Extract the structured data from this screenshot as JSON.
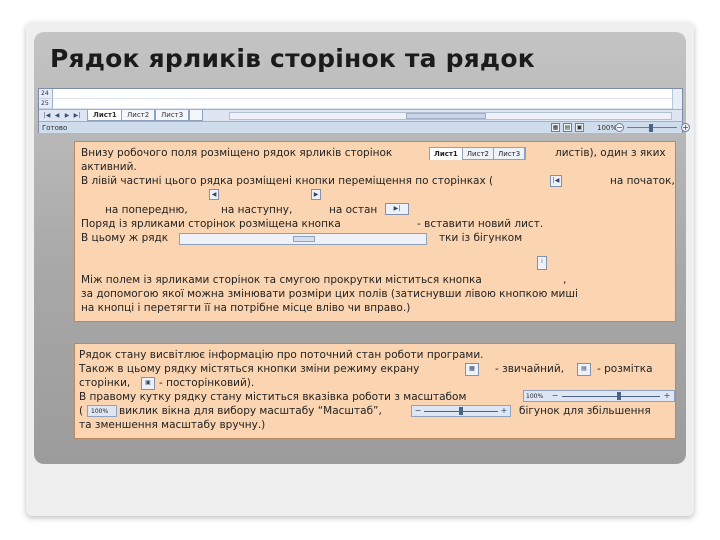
{
  "slide": {
    "title": "Рядок ярликів сторінок та рядок"
  },
  "excel": {
    "rows": [
      "24",
      "25"
    ],
    "nav_buttons": [
      "|◀",
      "◀",
      "▶",
      "▶|"
    ],
    "sheet_tabs": [
      "Лист1",
      "Лист2",
      "Лист3"
    ],
    "status": "Готово",
    "zoom": "100%",
    "zoom_minus": "−",
    "zoom_plus": "+"
  },
  "box1": {
    "l1a": "Внизу робочого поля розміщено рядок ярликів сторінок",
    "l1b": "листів), один з яких",
    "l2": "активний.",
    "l3a": "В лівій частині цього рядка розміщені кнопки переміщення по сторінках (",
    "l3b": "на початок,",
    "l4a": "на попередню,",
    "l4b": "на наступну,",
    "l4c": "на остан",
    "l5a": "Поряд із ярликами сторінок розміщена кнопка",
    "l5b": "- вставити новий лист.",
    "l6a": "В цьому ж рядк",
    "l6b": "тки із бігунком",
    "l7a": "Між полем із ярликами сторінок та смугою прокрутки міститься кнопка",
    "l7b": ",",
    "l8": "за допомогою якої можна змінювати розміри цих полів (затиснувши лівою кнопкою миші",
    "l9": "на кнопці і перетягти її на потрібне місце вліво чи вправо.)",
    "mini_tabs": [
      "Лист1",
      "Лист2",
      "Лист3"
    ],
    "btn_first": "|◀",
    "btn_prev": "◀",
    "btn_next": "▶",
    "btn_last": "▶|"
  },
  "box2": {
    "l1": "Рядок стану висвітлює інформацію про поточний стан роботи програми.",
    "l2a": "Також в цьому рядку містяться кнопки зміни режиму екрану",
    "l2b": "- звичайний,",
    "l2c": "- розмітка",
    "l3a": "сторінки,",
    "l3b": "- посторінковий).",
    "l4": "В правому кутку рядку стану міститься  вказівка роботи з масштабом",
    "l5a": "(",
    "l5b": "виклик вікна для вибору масштабу “Масштаб”,",
    "l5c": "бігунок для збільшення",
    "l6": "та зменшення масштабу вручну.)",
    "zoom_btn": "100%",
    "zoom_label": "100%",
    "minus": "−",
    "plus": "+"
  }
}
